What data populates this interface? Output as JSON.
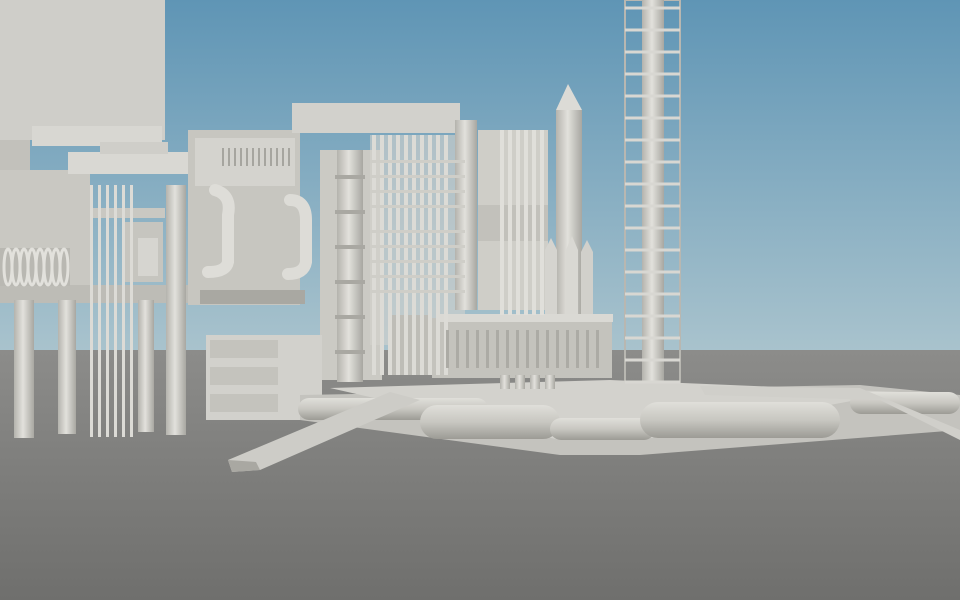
{
  "scene": {
    "description_label": "",
    "colors": {
      "sky_top": "#5f95b5",
      "sky_bottom": "#a7c1cc",
      "ground": "#767674",
      "ground_far": "#8a8a88",
      "structure_light": "#d6d5d0",
      "structure_mid": "#bdbcb6",
      "structure_dark": "#9e9d97",
      "line": "#8a8984"
    },
    "objects": [
      "launch-tower-icon",
      "rocket-icon",
      "lattice-tower-icon",
      "gantry-building-icon",
      "flame-trench-ramp-icon",
      "pipe-network-icon"
    ]
  }
}
